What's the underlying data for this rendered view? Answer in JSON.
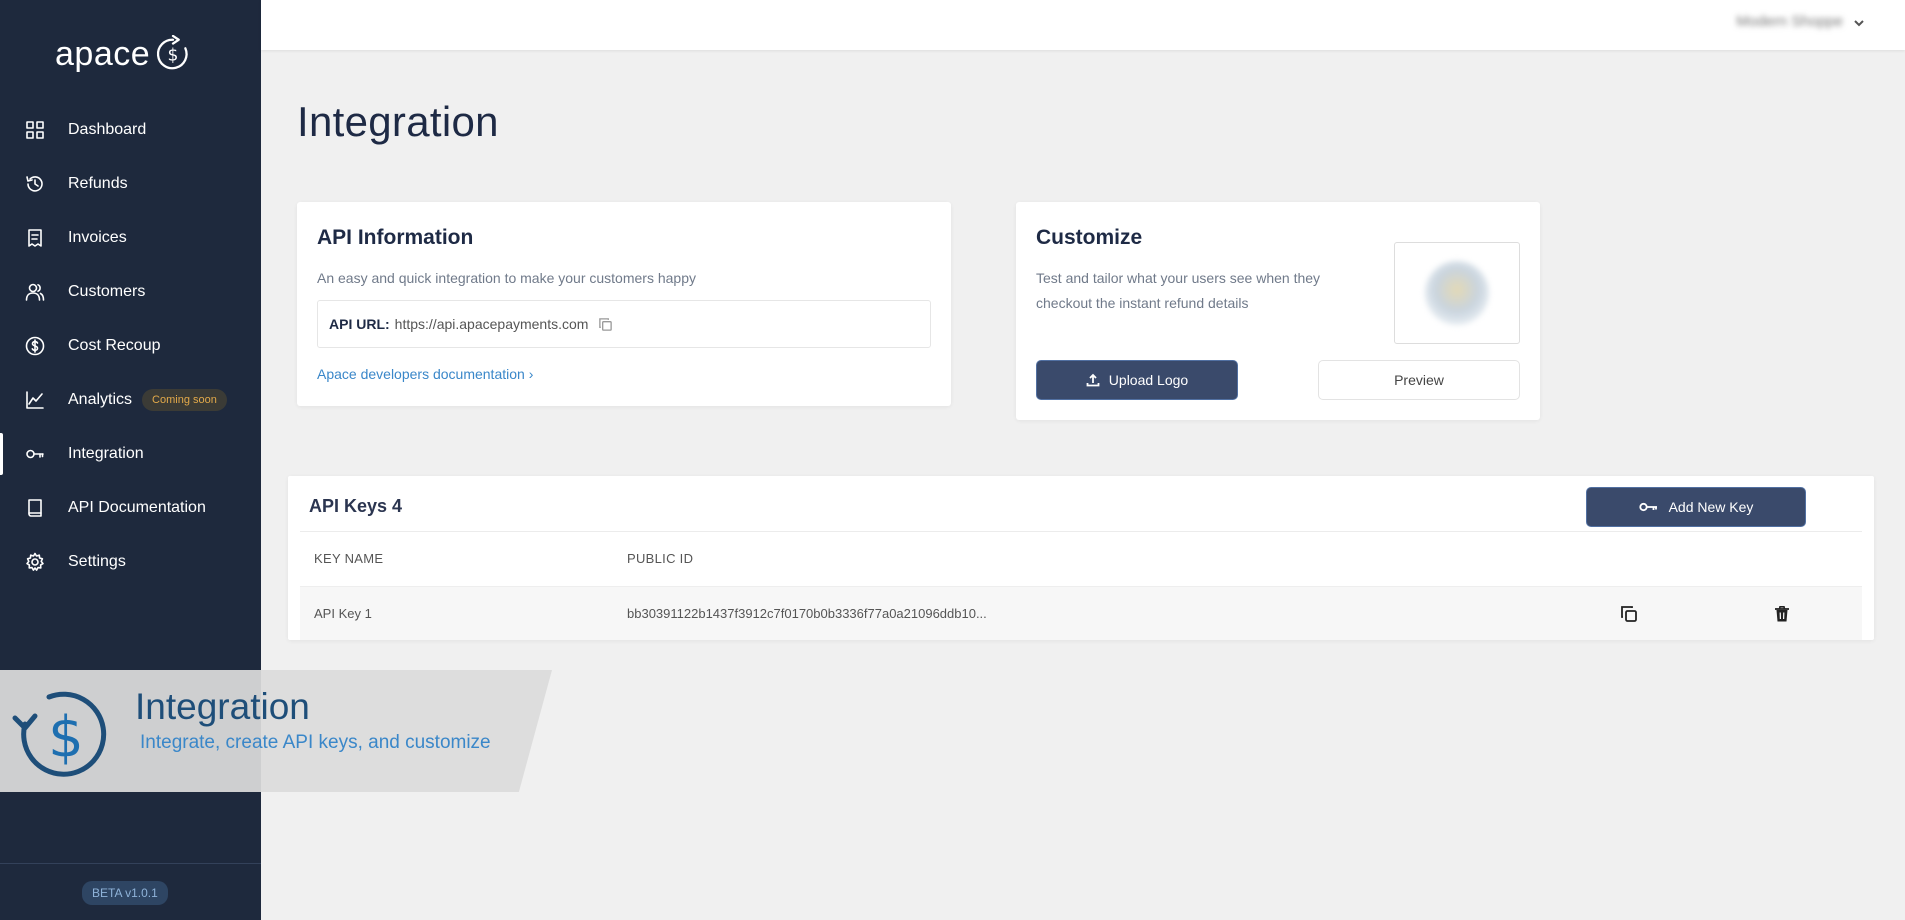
{
  "brand": {
    "name": "apace"
  },
  "sidebar": {
    "items": [
      {
        "label": "Dashboard",
        "icon": "grid-icon"
      },
      {
        "label": "Refunds",
        "icon": "history-icon"
      },
      {
        "label": "Invoices",
        "icon": "receipt-icon"
      },
      {
        "label": "Customers",
        "icon": "users-icon"
      },
      {
        "label": "Cost Recoup",
        "icon": "dollar-circle-icon"
      },
      {
        "label": "Analytics",
        "icon": "chart-line-icon",
        "badge": "Coming soon"
      },
      {
        "label": "Integration",
        "icon": "key-icon",
        "active": true
      },
      {
        "label": "API Documentation",
        "icon": "book-icon"
      },
      {
        "label": "Settings",
        "icon": "gear-icon"
      }
    ],
    "version": "BETA v1.0.1"
  },
  "topbar": {
    "user_name": "Modern Shoppe"
  },
  "page": {
    "title": "Integration"
  },
  "api_info": {
    "title": "API Information",
    "description": "An easy and quick integration to make your customers happy",
    "url_label": "API URL:",
    "url_value": "https://api.apacepayments.com",
    "docs_link": "Apace developers documentation"
  },
  "customize": {
    "title": "Customize",
    "description_line1": "Test and tailor what your users see when they",
    "description_line2": "checkout the instant refund details",
    "upload_label": "Upload Logo",
    "preview_label": "Preview"
  },
  "api_keys": {
    "title": "API Keys 4",
    "add_label": "Add New Key",
    "columns": [
      "KEY NAME",
      "PUBLIC ID"
    ],
    "rows": [
      {
        "name": "API Key 1",
        "public_id": "bb30391122b1437f3912c7f0170b0b3336f77a0a21096ddb10..."
      }
    ]
  },
  "banner": {
    "title": "Integration",
    "subtitle": "Integrate, create API keys, and customize"
  },
  "colors": {
    "sidebar_bg": "#1e293d",
    "accent_button": "#3a4a6b",
    "link": "#3a87c9",
    "badge_text": "#e2a94a"
  }
}
